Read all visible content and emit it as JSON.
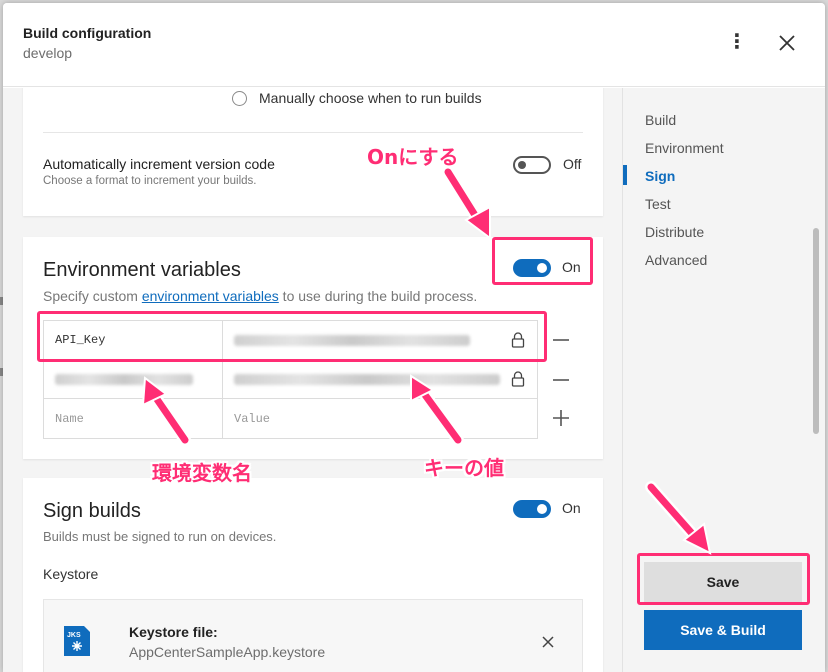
{
  "header": {
    "title": "Build configuration",
    "subtitle": "develop",
    "more_icon": "more-vertical-icon",
    "close_icon": "close-icon"
  },
  "build_schedule": {
    "manual_option_label": "Manually choose when to run builds",
    "manual_option_selected": false
  },
  "auto_increment": {
    "label": "Automatically increment version code",
    "help": "Choose a format to increment your builds.",
    "state_label": "Off",
    "enabled": false
  },
  "environment": {
    "title": "Environment variables",
    "help_prefix": "Specify custom ",
    "help_link": "environment variables",
    "help_suffix": " to use during the build process.",
    "state_label": "On",
    "enabled": true,
    "rows": [
      {
        "name": "API_Key",
        "value_hidden": true
      }
    ],
    "new_row": {
      "name_placeholder": "Name",
      "value_placeholder": "Value"
    }
  },
  "sign": {
    "title": "Sign builds",
    "help": "Builds must be signed to run on devices.",
    "state_label": "On",
    "enabled": true,
    "keystore_label": "Keystore",
    "file_badge": "JKS",
    "file_title": "Keystore file:",
    "file_name": "AppCenterSampleApp.keystore"
  },
  "nav": {
    "items": [
      {
        "label": "Build",
        "active": false
      },
      {
        "label": "Environment",
        "active": false
      },
      {
        "label": "Sign",
        "active": true
      },
      {
        "label": "Test",
        "active": false
      },
      {
        "label": "Distribute",
        "active": false
      },
      {
        "label": "Advanced",
        "active": false
      }
    ]
  },
  "actions": {
    "save_label": "Save",
    "save_build_label": "Save & Build"
  },
  "annotations": {
    "on_note": "Onにする",
    "var_name_note": "環境変数名",
    "key_value_note": "キーの値",
    "color": "#ff2d74"
  },
  "colors": {
    "accent": "#0f6cbd",
    "highlight": "#ff2d74"
  }
}
